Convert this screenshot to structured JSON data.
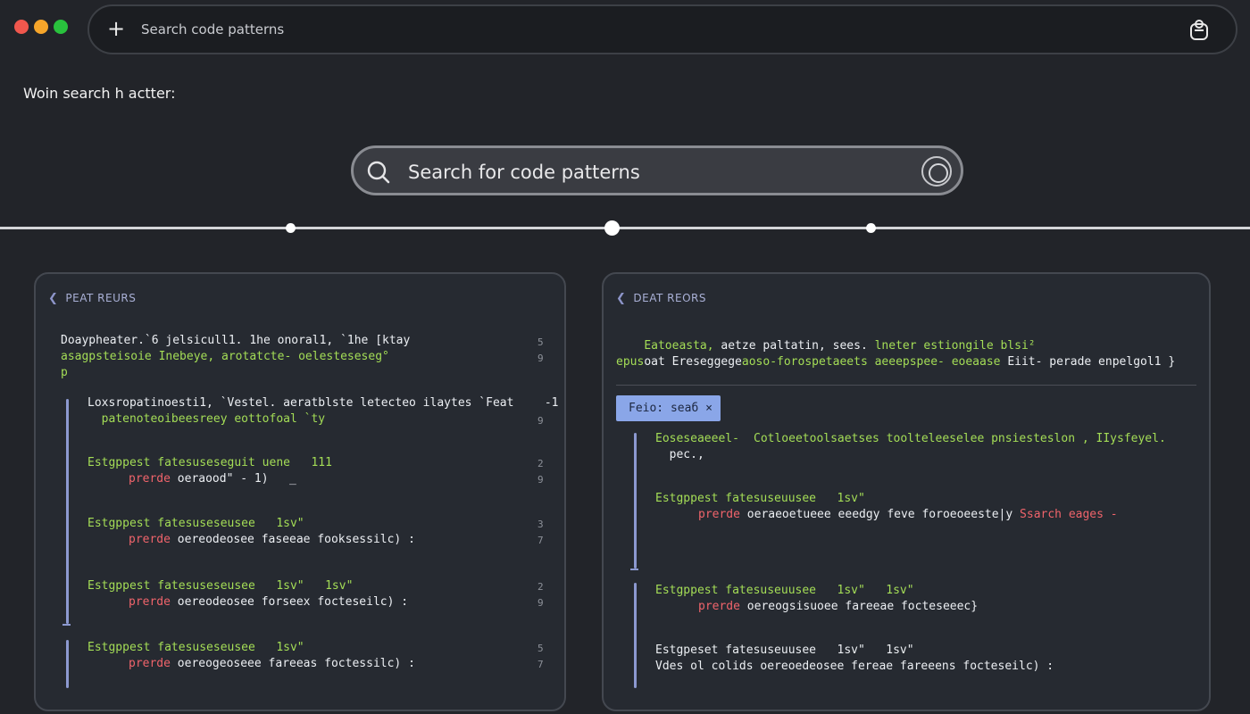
{
  "window": {
    "controls": [
      {
        "name": "close",
        "color": "#f0574d"
      },
      {
        "name": "minimize",
        "color": "#f6a52a"
      },
      {
        "name": "maximize",
        "color": "#29c23d"
      }
    ]
  },
  "topbar": {
    "new_icon": "plus-icon",
    "placeholder": "Search code patterns",
    "profile_icon": "profile-icon"
  },
  "page": {
    "heading": "Woin search h actter:"
  },
  "search": {
    "placeholder": "Search for code patterns",
    "search_icon": "magnifier-icon",
    "options_icon": "options-icon"
  },
  "timeline": {
    "points": 3,
    "active_index": 1
  },
  "left_panel": {
    "title": "PEAT REURS",
    "intro": {
      "lines": [
        {
          "color": "white",
          "text": "Doaypheater.`6 jelsicull1. 1he onoral1, `1he [ktay"
        },
        {
          "color": "green",
          "text": "asagpsteisoie Inebeye, arotatcte- oelesteseseg°"
        },
        {
          "color": "green",
          "text": "p"
        }
      ],
      "nums": [
        "5",
        "9"
      ]
    },
    "results": [
      {
        "line1": "Loxsropatinoesti1, `Vestel. aeratblste letecteo ilaytes `Feat",
        "line1_tail": " -1",
        "line2": "  patenoteoibeesreey eottofoal `ty",
        "line2_red": "",
        "line1_color": "white",
        "nums": [
          "",
          "9"
        ]
      },
      {
        "line1": "Estgppest fatesuseseguit uene   111",
        "line1_tail": "",
        "line2": "",
        "line2_red": "prerde",
        "line2_rest": " oeraood\" - 1)   _",
        "line1_color": "green",
        "nums": [
          "2",
          "9"
        ]
      },
      {
        "line1": "Estgppest fatesuseseusee   1sv\"",
        "line1_tail": "",
        "line2": "",
        "line2_red": "prerde",
        "line2_rest": " oereodeosee faseeae fooksessilc) :",
        "line1_color": "green",
        "nums": [
          "3",
          "7"
        ]
      },
      {
        "line1": "Estgppest fatesuseseusee   1sv\"   1sv\"",
        "line1_tail": "",
        "line2": "",
        "line2_red": "prerde",
        "line2_rest": " oereodeosee forseex focteseilc) :",
        "line1_color": "green",
        "nums": [
          "2",
          "9"
        ]
      },
      {
        "line1": "Estgppest fatesuseseusee   1sv\"",
        "line1_tail": "",
        "line2": "",
        "line2_red": "prerde",
        "line2_rest": " oereogeoseee fareeas foctessilc) :",
        "line1_color": "green",
        "nums": [
          "5",
          "7"
        ]
      }
    ]
  },
  "right_panel": {
    "title": "DEAT REORS",
    "intro": {
      "lines": [
        {
          "parts": [
            {
              "c": "green",
              "t": "Eatoeasta, "
            },
            {
              "c": "white",
              "t": "aetze paltatin, sees. "
            },
            {
              "c": "green",
              "t": "lneter estiongile blsi²"
            }
          ]
        },
        {
          "parts": [
            {
              "c": "white",
              "t": "oat Ereseggege"
            },
            {
              "c": "green",
              "t": "aoso-forospetaeets aeeepspee- eoeaase "
            },
            {
              "c": "white",
              "t": "Eiit- perade enpelgol1 }"
            }
          ]
        },
        {
          "parts": [
            {
              "c": "green",
              "t": "epus"
            }
          ]
        }
      ]
    },
    "chip": {
      "label": "Feio: seaб ×"
    },
    "results": [
      {
        "parts1": [
          {
            "c": "green",
            "t": "Eoseseaeeel- "
          },
          {
            "c": "green",
            "t": "Cotloeetoolsaetses toolteleeselee pnsiesteslon , IIysfeyel."
          }
        ],
        "line2": "  pec.,",
        "red": "",
        "rest": ""
      },
      {
        "parts1": [
          {
            "c": "green",
            "t": "Estgppest fatesuseuusee   1sv\""
          }
        ],
        "line2": "",
        "red": "prerde",
        "rest": " oeraeoetueee eeedgy feve foroeoeeste|y",
        "trail": " Ssarch eages -"
      },
      {
        "parts1": [
          {
            "c": "green",
            "t": "Estgppest fatesuseuusee   1sv\"   1sv\""
          }
        ],
        "line2": "",
        "red": "prerde",
        "rest": " oereogsisuoee fareeae focteseeec}",
        "trail": ""
      },
      {
        "parts1": [
          {
            "c": "white",
            "t": "Estgpeset fatesuseuusee   1sv\"   1sv\""
          }
        ],
        "line2": "Vdes ol colids oereoedeosee fereae fareeens focteseilc) :",
        "red": "",
        "rest": "",
        "trail": ""
      }
    ]
  }
}
